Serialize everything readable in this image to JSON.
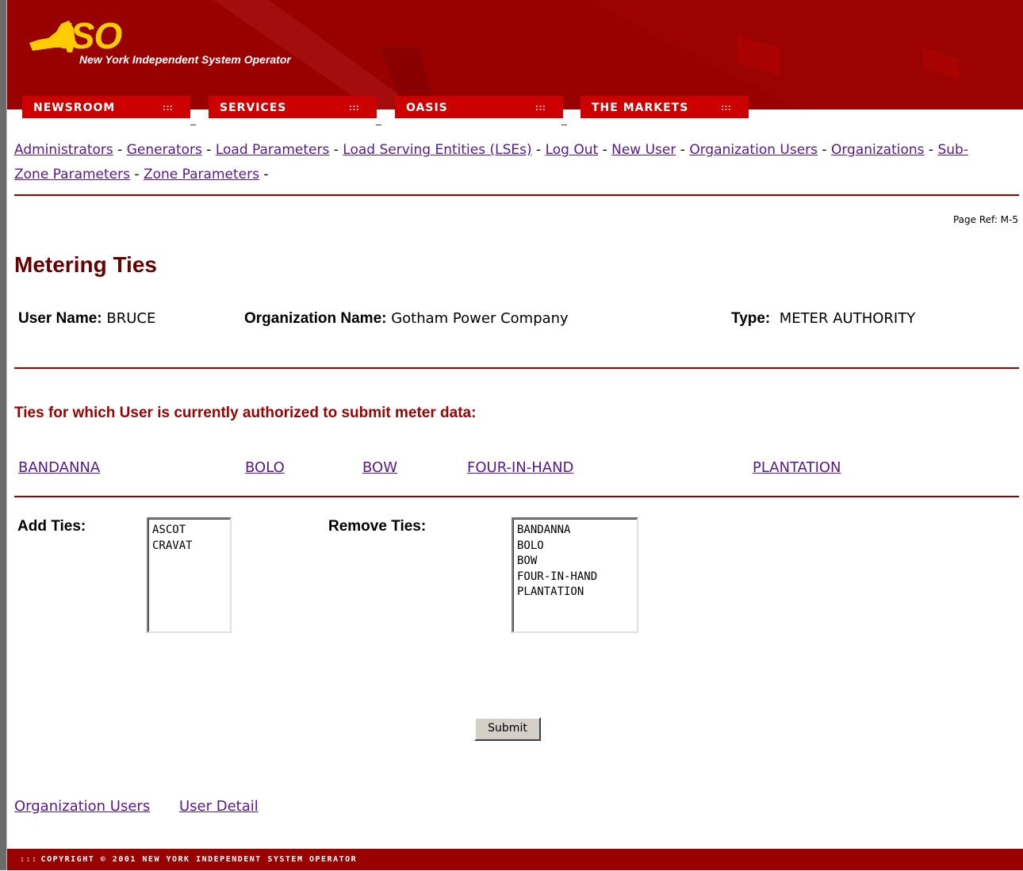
{
  "brand": {
    "logo_text": "ISO",
    "subtitle": "New York Independent System Operator",
    "colors": {
      "primary": "#990000",
      "tab": "#cc0000",
      "logo": "#ffcc00",
      "link": "#551a8b"
    }
  },
  "nav": {
    "tabs": [
      {
        "label": "NEWSROOM"
      },
      {
        "label": "SERVICES"
      },
      {
        "label": "OASIS"
      },
      {
        "label": "THE MARKETS"
      }
    ],
    "tab_dots": ":::"
  },
  "links": [
    "Administrators",
    "Generators",
    "Load Parameters",
    "Load Serving Entities (LSEs)",
    "Log Out",
    "New User",
    "Organization Users",
    "Organizations",
    "Sub-Zone Parameters",
    "Zone Parameters"
  ],
  "separator": "-",
  "page": {
    "ref": "Page Ref: M-5",
    "title": "Metering Ties"
  },
  "user_info": {
    "user_name_label": "User Name:",
    "user_name": "BRUCE",
    "org_label": "Organization Name:",
    "org_name": "Gotham Power Company",
    "type_label": "Type:",
    "type": "METER AUTHORITY"
  },
  "authorized": {
    "heading": "Ties for which User is currently authorized to submit meter data:",
    "ties": [
      "BANDANNA",
      "BOLO",
      "BOW",
      "FOUR-IN-HAND",
      "PLANTATION"
    ]
  },
  "form": {
    "add_label": "Add Ties:",
    "add_options": [
      "ASCOT",
      "CRAVAT"
    ],
    "remove_label": "Remove Ties:",
    "remove_options": [
      "BANDANNA",
      "BOLO",
      "BOW",
      "FOUR-IN-HAND",
      "PLANTATION"
    ],
    "submit_label": "Submit"
  },
  "bottom_links": [
    "Organization Users",
    "User Detail"
  ],
  "footer": {
    "dots": ":::",
    "text": "COPYRIGHT © 2001 NEW YORK INDEPENDENT SYSTEM OPERATOR"
  }
}
